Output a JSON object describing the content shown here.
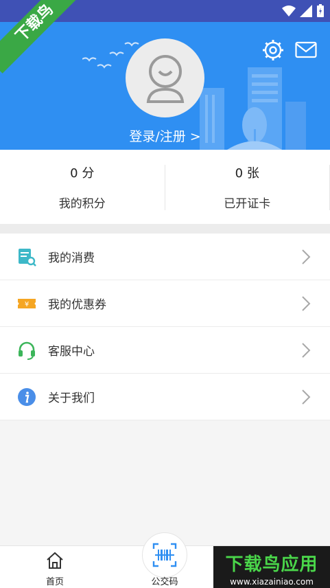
{
  "ribbon": {
    "text": "下载鸟"
  },
  "header": {
    "icons": [
      "settings-icon",
      "mail-icon",
      "avatar-icon"
    ],
    "login_label": "登录/注册 >",
    "accent": "#2f8ff2"
  },
  "stats": [
    {
      "value": "0 分",
      "label": "我的积分"
    },
    {
      "value": "0 张",
      "label": "已开证卡"
    }
  ],
  "menu": [
    {
      "label": "我的消费",
      "icon": "receipt-icon",
      "color": "#3db8c8"
    },
    {
      "label": "我的优惠券",
      "icon": "coupon-icon",
      "color": "#f5a623"
    },
    {
      "label": "客服中心",
      "icon": "headset-icon",
      "color": "#3cb55a"
    },
    {
      "label": "关于我们",
      "icon": "info-icon",
      "color": "#4a8ee8"
    }
  ],
  "tabbar": {
    "home_label": "首页",
    "bus_label": "公交码"
  },
  "watermark": {
    "title": "下载鸟应用",
    "url": "www.xiazainiao.com"
  }
}
